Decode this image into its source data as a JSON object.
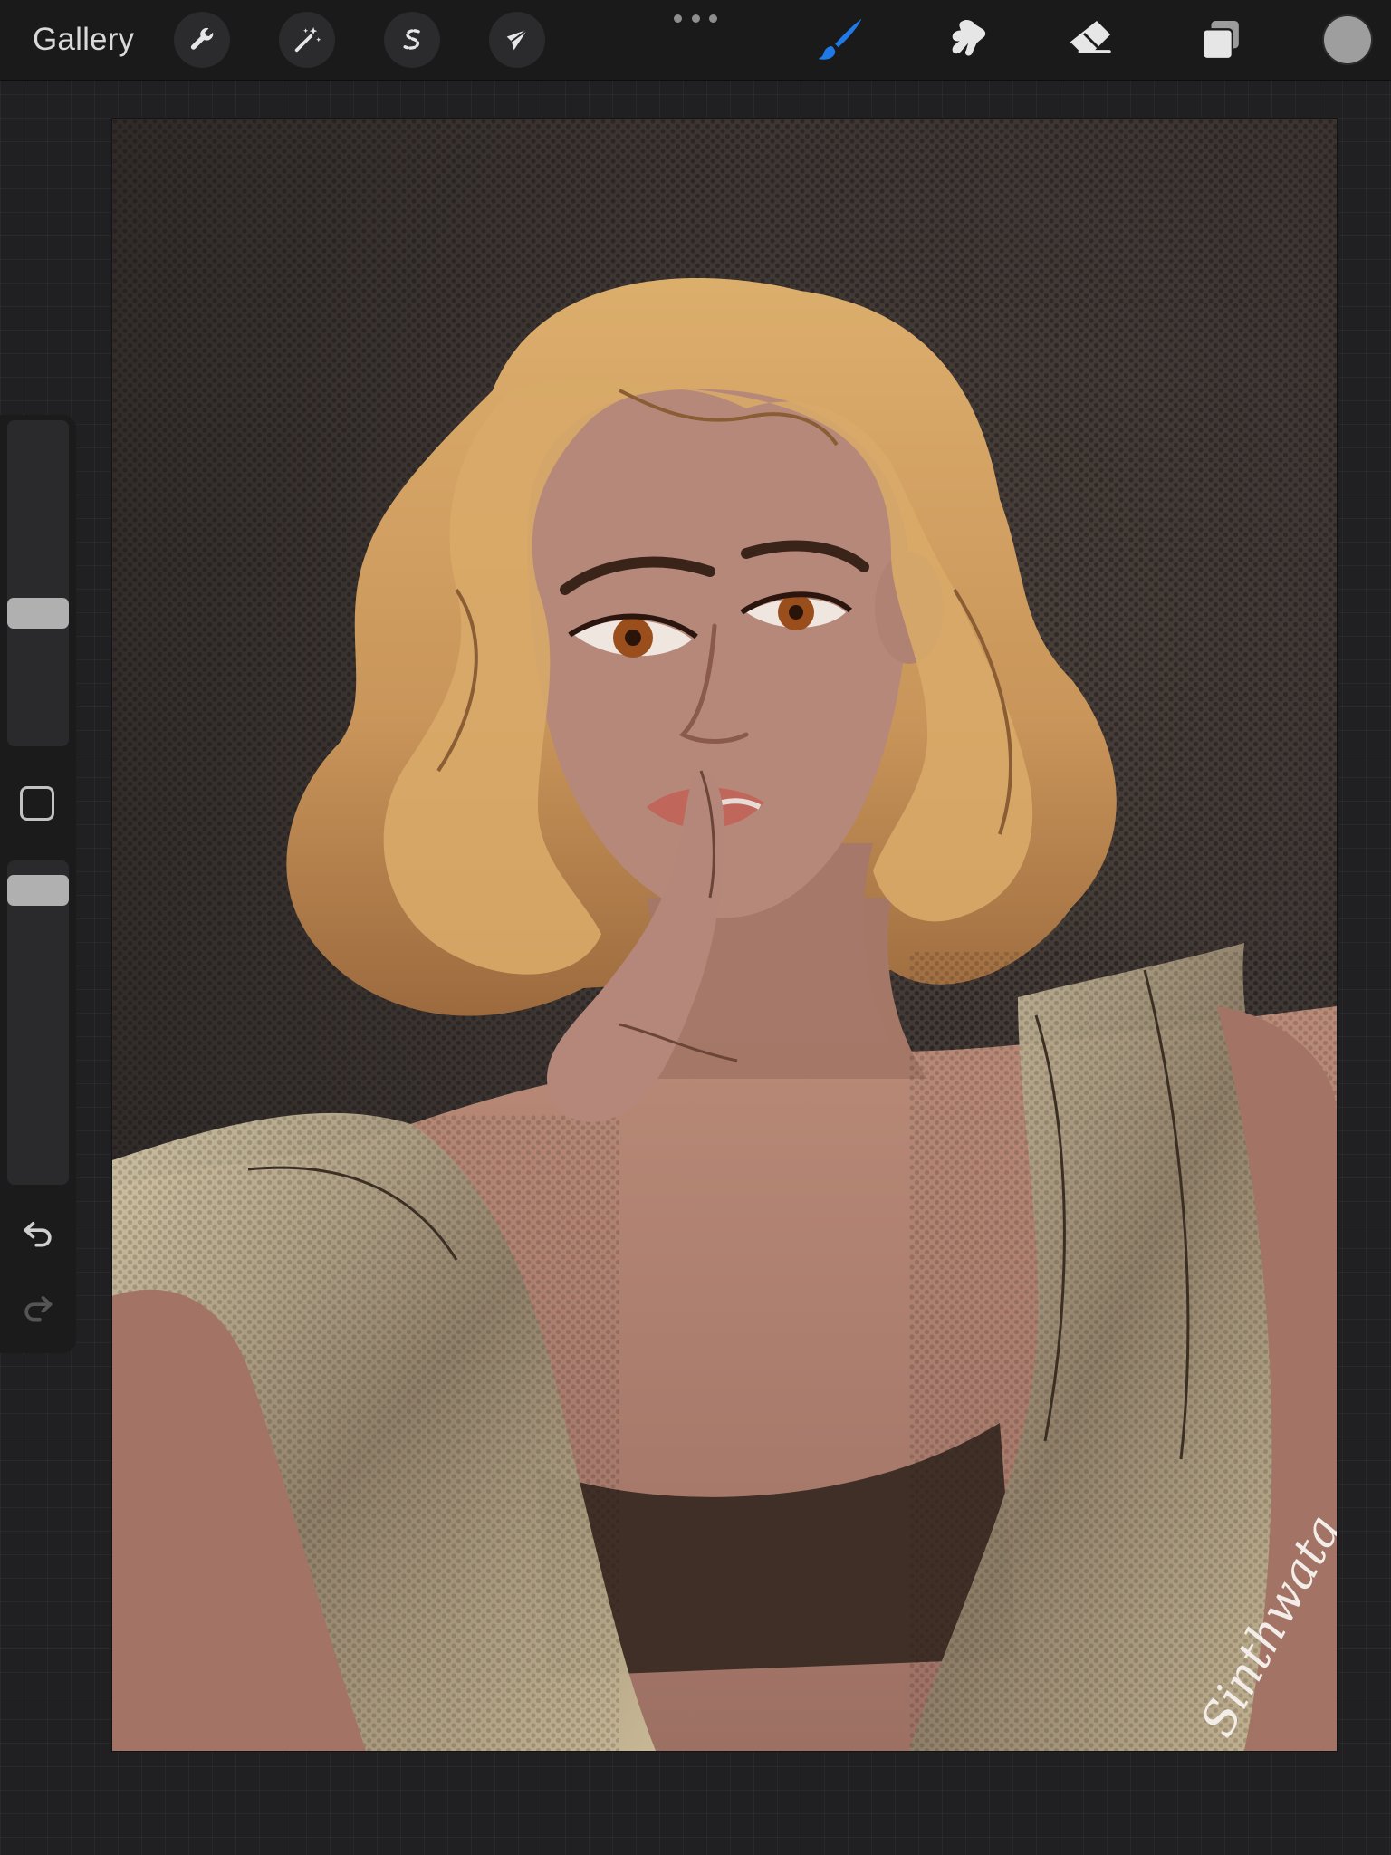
{
  "toolbar": {
    "gallery_label": "Gallery",
    "left_tools": [
      {
        "name": "actions",
        "icon": "wrench-icon"
      },
      {
        "name": "adjustments",
        "icon": "magic-wand-icon"
      },
      {
        "name": "selection",
        "icon": "selection-s-icon"
      },
      {
        "name": "transform",
        "icon": "arrow-cursor-icon"
      }
    ],
    "more_icon": "more-dots-icon",
    "right_tools": [
      {
        "name": "brush",
        "icon": "brush-icon",
        "active": true
      },
      {
        "name": "smudge",
        "icon": "smudge-icon",
        "active": false
      },
      {
        "name": "eraser",
        "icon": "eraser-icon",
        "active": false
      },
      {
        "name": "layers",
        "icon": "layers-icon",
        "active": false
      }
    ],
    "current_color": "#9e9e9e",
    "active_tool_color": "#1f7ae8"
  },
  "sidebar": {
    "brush_size_level": 0.4,
    "opacity_level": 0.95,
    "modify_button_icon": "square-icon",
    "undo_icon": "undo-icon",
    "redo_icon": "redo-icon",
    "redo_enabled": false
  },
  "canvas": {
    "signature_text": "Sinthwata"
  }
}
